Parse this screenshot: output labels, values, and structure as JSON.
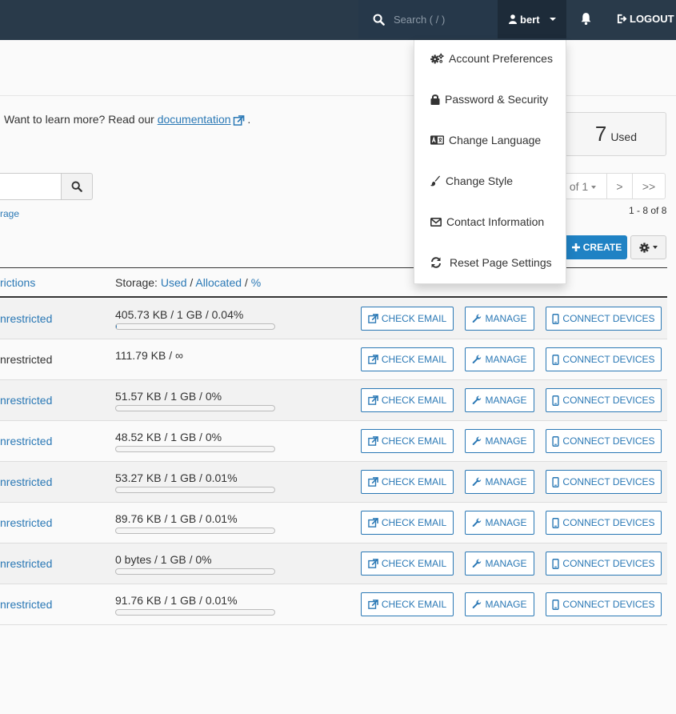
{
  "header": {
    "search_placeholder": "Search ( / )",
    "user_name": "bert",
    "logout_label": "LOGOUT"
  },
  "user_menu": {
    "items": [
      {
        "label": "Account Preferences",
        "icon": "cogs-icon"
      },
      {
        "label": "Password & Security",
        "icon": "lock-icon"
      },
      {
        "label": "Change Language",
        "icon": "language-icon"
      },
      {
        "label": "Change Style",
        "icon": "paintbrush-icon"
      },
      {
        "label": "Contact Information",
        "icon": "envelope-icon"
      },
      {
        "label": "Reset Page Settings",
        "icon": "refresh-icon"
      }
    ]
  },
  "info": {
    "text": "Want to learn more? Read our",
    "link_label": "documentation",
    "suffix": "."
  },
  "used_box": {
    "count": "7",
    "label": "Used"
  },
  "storage_link": "rage",
  "pagination": {
    "page_label": "of 1",
    "next": ">",
    "last": ">>",
    "range": "1 - 8 of 8"
  },
  "toolbar": {
    "create_label": "CREATE"
  },
  "table": {
    "header_restrictions": "rictions",
    "header_storage_prefix": "Storage:",
    "header_used": "Used",
    "header_allocated": "Allocated",
    "header_percent": "%",
    "slash": "/",
    "rows": [
      {
        "restriction": "nrestricted",
        "link": true,
        "usage": "405.73 KB / 1 GB / 0.04%",
        "percent": 0.04,
        "has_bar": true
      },
      {
        "restriction": "nrestricted",
        "link": false,
        "usage": "111.79 KB / ∞",
        "percent": 0,
        "has_bar": false
      },
      {
        "restriction": "nrestricted",
        "link": true,
        "usage": "51.57 KB / 1 GB / 0%",
        "percent": 0,
        "has_bar": true
      },
      {
        "restriction": "nrestricted",
        "link": true,
        "usage": "48.52 KB / 1 GB / 0%",
        "percent": 0,
        "has_bar": true
      },
      {
        "restriction": "nrestricted",
        "link": true,
        "usage": "53.27 KB / 1 GB / 0.01%",
        "percent": 0.01,
        "has_bar": true
      },
      {
        "restriction": "nrestricted",
        "link": true,
        "usage": "89.76 KB / 1 GB / 0.01%",
        "percent": 0.01,
        "has_bar": true
      },
      {
        "restriction": "nrestricted",
        "link": true,
        "usage": "0 bytes / 1 GB / 0%",
        "percent": 0,
        "has_bar": true
      },
      {
        "restriction": "nrestricted",
        "link": true,
        "usage": "91.76 KB / 1 GB / 0.01%",
        "percent": 0.01,
        "has_bar": true
      }
    ],
    "check_email_label": "CHECK EMAIL",
    "manage_label": "MANAGE",
    "connect_label": "CONNECT DEVICES"
  }
}
